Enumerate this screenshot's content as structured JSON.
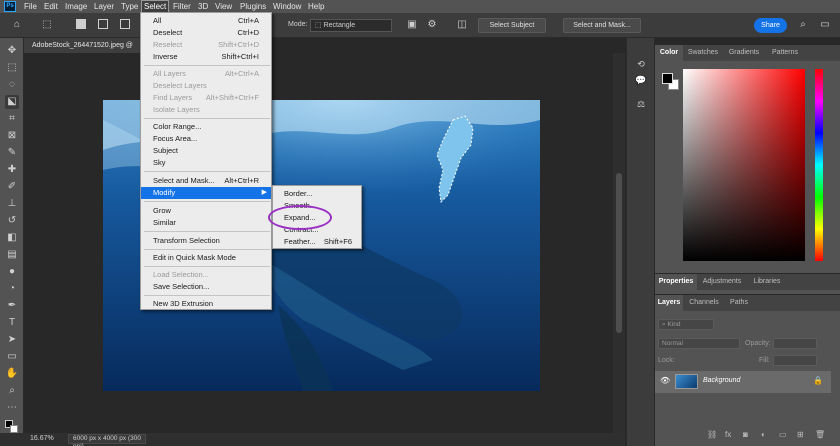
{
  "menubar": {
    "logo": "Ps",
    "items": [
      "File",
      "Edit",
      "Image",
      "Layer",
      "Type",
      "Select",
      "Filter",
      "3D",
      "View",
      "Plugins",
      "Window",
      "Help"
    ],
    "active": "Select"
  },
  "options": {
    "mode_label": "Mode:",
    "mode_value": "Rectangle",
    "select_subject": "Select Subject",
    "select_and_mask": "Select and Mask...",
    "share": "Share"
  },
  "document": {
    "tab_title": "AdobeStock_264471520.jpeg @",
    "zoom": "16.67%",
    "info": "6000 px x 4000 px (300 ppi)"
  },
  "select_menu": {
    "items": [
      {
        "label": "All",
        "shortcut": "Ctrl+A",
        "enabled": true
      },
      {
        "label": "Deselect",
        "shortcut": "Ctrl+D",
        "enabled": true
      },
      {
        "label": "Reselect",
        "shortcut": "Shift+Ctrl+D",
        "enabled": false
      },
      {
        "label": "Inverse",
        "shortcut": "Shift+Ctrl+I",
        "enabled": true
      },
      {
        "label": "All Layers",
        "shortcut": "Alt+Ctrl+A",
        "enabled": false
      },
      {
        "label": "Deselect Layers",
        "shortcut": "",
        "enabled": false
      },
      {
        "label": "Find Layers",
        "shortcut": "Alt+Shift+Ctrl+F",
        "enabled": false
      },
      {
        "label": "Isolate Layers",
        "shortcut": "",
        "enabled": false
      },
      {
        "label": "Color Range...",
        "shortcut": "",
        "enabled": true
      },
      {
        "label": "Focus Area...",
        "shortcut": "",
        "enabled": true
      },
      {
        "label": "Subject",
        "shortcut": "",
        "enabled": true
      },
      {
        "label": "Sky",
        "shortcut": "",
        "enabled": true
      },
      {
        "label": "Select and Mask...",
        "shortcut": "Alt+Ctrl+R",
        "enabled": true
      },
      {
        "label": "Modify",
        "shortcut": "",
        "enabled": true,
        "highlighted": true
      },
      {
        "label": "Grow",
        "shortcut": "",
        "enabled": true
      },
      {
        "label": "Similar",
        "shortcut": "",
        "enabled": true
      },
      {
        "label": "Transform Selection",
        "shortcut": "",
        "enabled": true
      },
      {
        "label": "Edit in Quick Mask Mode",
        "shortcut": "",
        "enabled": true
      },
      {
        "label": "Load Selection...",
        "shortcut": "",
        "enabled": false
      },
      {
        "label": "Save Selection...",
        "shortcut": "",
        "enabled": true
      },
      {
        "label": "New 3D Extrusion",
        "shortcut": "",
        "enabled": true
      }
    ]
  },
  "modify_submenu": {
    "items": [
      {
        "label": "Border...",
        "shortcut": ""
      },
      {
        "label": "Smooth...",
        "shortcut": ""
      },
      {
        "label": "Expand...",
        "shortcut": ""
      },
      {
        "label": "Contract...",
        "shortcut": ""
      },
      {
        "label": "Feather...",
        "shortcut": "Shift+F6"
      }
    ]
  },
  "color_panel": {
    "tabs": [
      "Color",
      "Swatches",
      "Gradients",
      "Patterns"
    ],
    "foreground": "#000000",
    "background": "#ffffff",
    "hue": "#ff0000"
  },
  "properties_panel": {
    "tabs": [
      "Properties",
      "Adjustments",
      "Libraries"
    ]
  },
  "layers_panel": {
    "tabs": [
      "Layers",
      "Channels",
      "Paths"
    ],
    "kind_label": "Kind",
    "blend_mode": "Normal",
    "opacity_label": "Opacity:",
    "lock_label": "Lock:",
    "fill_label": "Fill:",
    "layer_name": "Background"
  },
  "colors": {
    "accent": "#1473e6",
    "annotation": "#9a2fc4"
  }
}
